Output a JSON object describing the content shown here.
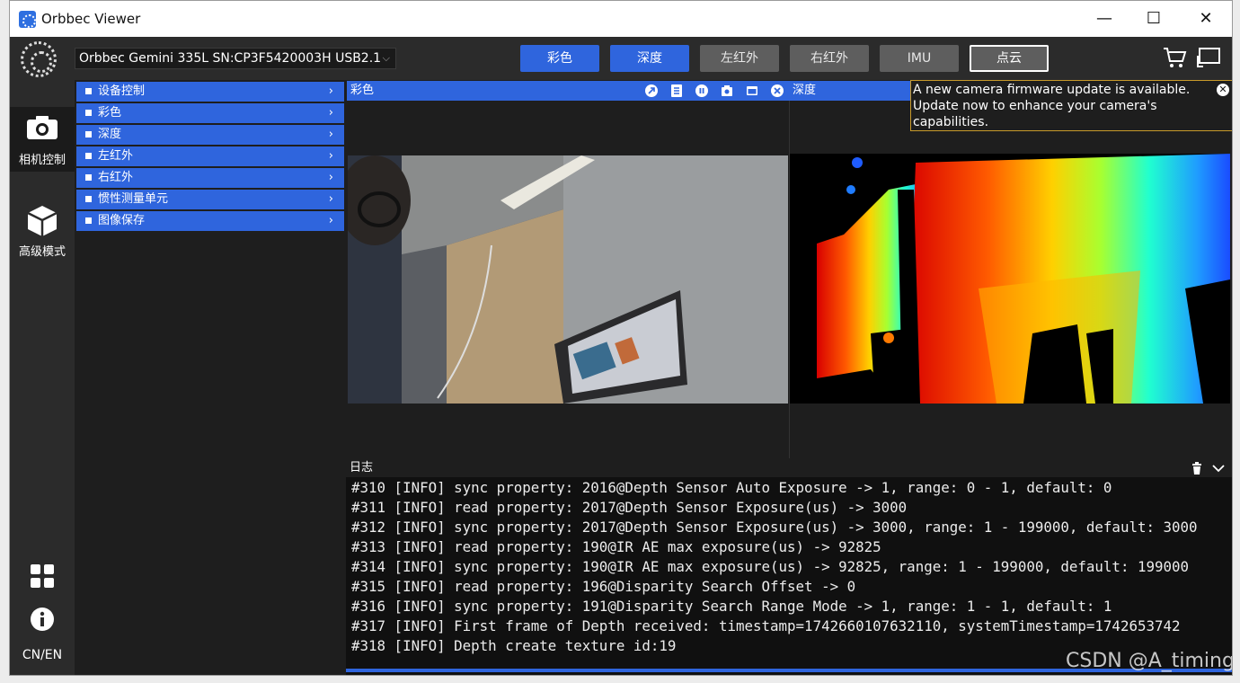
{
  "window": {
    "title": "Orbbec Viewer",
    "min_glyph": "—",
    "max_glyph": "☐",
    "close_glyph": "✕"
  },
  "toolbar": {
    "device": "Orbbec Gemini 335L SN:CP3F5420003H USB2.1",
    "tabs": [
      {
        "label": "彩色",
        "state": "active"
      },
      {
        "label": "深度",
        "state": "active"
      },
      {
        "label": "左红外",
        "state": "inactive"
      },
      {
        "label": "右红外",
        "state": "inactive"
      },
      {
        "label": "IMU",
        "state": "inactive"
      },
      {
        "label": "点云",
        "state": "outlined"
      }
    ],
    "icons": [
      "cart-icon",
      "screen-icon"
    ]
  },
  "rail": {
    "camera_label": "相机控制",
    "advanced_label": "高级模式",
    "lang_label": "CN/EN"
  },
  "menu": {
    "items": [
      {
        "label": "设备控制"
      },
      {
        "label": "彩色"
      },
      {
        "label": "深度"
      },
      {
        "label": "左红外"
      },
      {
        "label": "右红外"
      },
      {
        "label": "惯性测量单元"
      },
      {
        "label": "图像保存"
      }
    ],
    "chevron": "›"
  },
  "panels": {
    "color_title": "彩色",
    "depth_title": "深度"
  },
  "toast": {
    "message": "A new camera firmware update is available. Update now to enhance your camera's capabilities."
  },
  "log": {
    "title": "日志",
    "lines": [
      "#310 [INFO] sync property: 2016@Depth Sensor Auto Exposure -> 1, range: 0 - 1, default: 0",
      "#311 [INFO] read property: 2017@Depth Sensor Exposure(us) -> 3000",
      "#312 [INFO] sync property: 2017@Depth Sensor Exposure(us) -> 3000, range: 1 - 199000, default: 3000",
      "#313 [INFO] read property: 190@IR AE max exposure(us) -> 92825",
      "#314 [INFO] sync property: 190@IR AE max exposure(us) -> 92825, range: 1 - 199000, default: 199000",
      "#315 [INFO] read property: 196@Disparity Search Offset -> 0",
      "#316 [INFO] sync property: 191@Disparity Search Range Mode -> 1, range: 1 - 1, default: 1",
      "#317 [INFO] First frame of Depth received: timestamp=1742660107632110, systemTimestamp=1742653742",
      "#318 [INFO] Depth create texture id:19"
    ]
  },
  "watermark": "CSDN @A_timing",
  "colors": {
    "accent": "#2f65dd",
    "inactive_tab": "#5e5e5e",
    "toast_border": "#c89a2a",
    "background": "#1e1e1e"
  }
}
